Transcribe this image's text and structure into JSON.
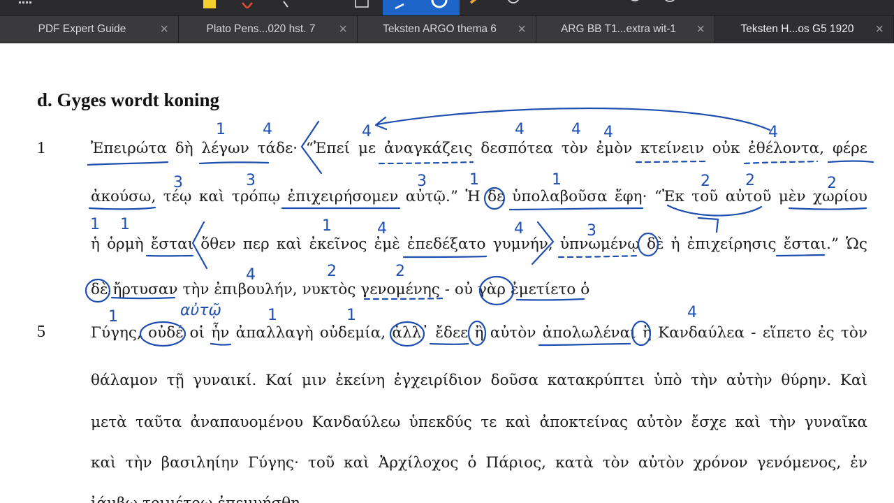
{
  "toolbar": {
    "icons": [
      "grid-icon",
      "highlight-icon",
      "text-markup-icon",
      "pen-tool-icon",
      "shape-icon",
      "annotate-pen-icon",
      "circle-select-icon",
      "marker-icon",
      "stamp-icon",
      "note-icon",
      "signature-icon",
      "more-icon"
    ]
  },
  "tabs": [
    {
      "label": "PDF Expert Guide"
    },
    {
      "label": "Plato Pens...020 hst. 7"
    },
    {
      "label": "Teksten ARGO thema 6"
    },
    {
      "label": "ARG BB T1...extra wit-1"
    },
    {
      "label": "Teksten H...os G5 1920"
    }
  ],
  "close_glyph": "×",
  "document": {
    "heading": "d. Gyges wordt koning",
    "line_numbers": [
      "1",
      "5"
    ],
    "lines": [
      "Ἐπειρώτα δὴ λέγων τάδε· “Ἐπεί με ἀναγκάζεις δεσπότεα τὸν ἐμὸν κτείνειν οὐκ ἐθέλοντα, φέρε",
      "ἀκούσω, τέῳ καὶ τρόπῳ ἐπιχειρήσομεν αὐτῷ.” Ἡ δὲ ὑπολαβοῦσα ἔφη· “Ἐκ τοῦ αὐτοῦ μὲν χωρίου",
      "ἡ ὁρμὴ ἔσται ὅθεν περ καὶ ἐκεῖνος ἐμὲ ἐπεδέξατο γυμνήν, ὑπνωμένῳ δὲ ἡ ἐπιχείρησις ἔσται.” Ὡς",
      "δὲ ἤρτυσαν τὴν ἐπιβουλήν, νυκτὸς γενομένης - οὐ γὰρ ἐμετίετο ὁ",
      "Γύγης, οὐδέ οἱ ἦν ἀπαλλαγὴ οὐδεμία, ἀλλ᾽ ἔδεε ἢ αὐτὸν ἀπολωλέναι ἢ Κανδαύλεα - εἵπετο ἐς τὸν",
      "θάλαμον τῇ γυναικί. Καί μιν ἐκείνη ἐγχειρίδιον δοῦσα κατακρύπτει ὑπὸ τὴν αὐτὴν θύρην. Καὶ",
      "μετὰ ταῦτα ἀναπαυομένου Κανδαύλεω ὑπεκδύς τε καὶ ἀποκτείνας αὐτὸν ἔσχε καὶ τὴν γυναῖκα",
      "καὶ τὴν βασιληίην Γύγης· τοῦ καὶ Ἀρχίλοχος ὁ Πάριος, κατὰ τὸν αὐτὸν χρόνον γενόμενος, ἐν",
      "ἰάμβῳ τριμέτρῳ ἐπεμνήσθη."
    ]
  },
  "annotations": {
    "numbers": [
      "1",
      "4",
      "4",
      "4",
      "4",
      "4",
      "4",
      "3",
      "3",
      "3",
      "1",
      "1",
      "2",
      "2",
      "2",
      "1",
      "1",
      "1",
      "4",
      "4",
      "3",
      "4",
      "2",
      "2",
      "1",
      "1",
      "1",
      "4"
    ],
    "word": "αὐτῷ",
    "ink_color": "#1e4fb0"
  }
}
